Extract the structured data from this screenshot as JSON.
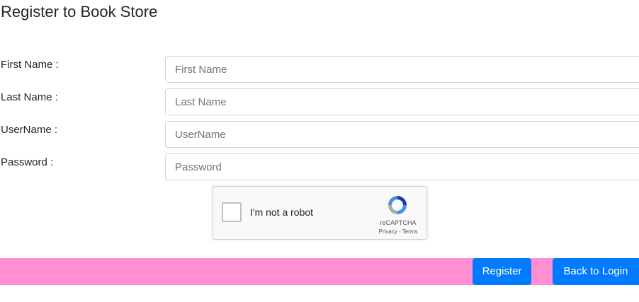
{
  "page": {
    "title": "Register to Book Store"
  },
  "form": {
    "fields": [
      {
        "label": "First Name :",
        "placeholder": "First Name",
        "value": ""
      },
      {
        "label": "Last Name :",
        "placeholder": "Last Name",
        "value": ""
      },
      {
        "label": "UserName :",
        "placeholder": "UserName",
        "value": ""
      },
      {
        "label": "Password :",
        "placeholder": "Password",
        "value": ""
      }
    ]
  },
  "captcha": {
    "checkbox_label": "I'm not a robot",
    "checked": false,
    "brand": "reCAPTCHA",
    "privacy_label": "Privacy",
    "separator": " - ",
    "terms_label": "Terms",
    "icon": "recaptcha-logo-icon"
  },
  "footer": {
    "bar_color": "#ff8fd2",
    "register_label": "Register",
    "back_label": "Back to Login",
    "button_color": "#007bff"
  }
}
